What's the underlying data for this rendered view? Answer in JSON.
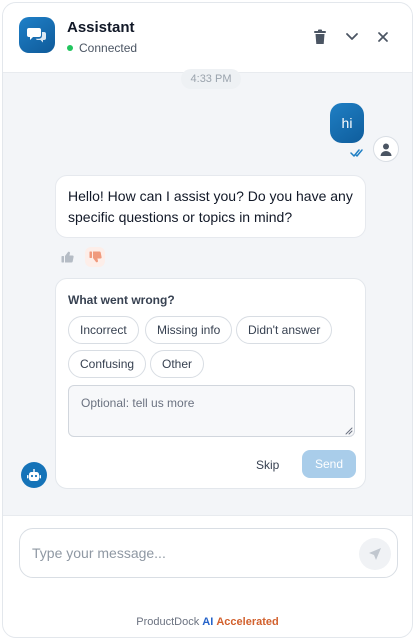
{
  "header": {
    "title": "Assistant",
    "status": "Connected",
    "logo_icon": "chat-bubbles-icon",
    "actions": [
      "trash-icon",
      "chevron-down-icon",
      "close-icon"
    ]
  },
  "chat": {
    "timestamp": "4:33 PM",
    "user_message": "hi",
    "bot_message": "Hello! How can I assist you? Do you have any specific questions or topics in mind?"
  },
  "feedback": {
    "title": "What went wrong?",
    "chips": [
      "Incorrect",
      "Missing info",
      "Didn't answer",
      "Confusing",
      "Other"
    ],
    "placeholder": "Optional: tell us more",
    "skip_label": "Skip",
    "send_label": "Send"
  },
  "composer": {
    "placeholder": "Type your message..."
  },
  "footer": {
    "brand_prefix": "ProductDock",
    "brand_ai": "AI",
    "brand_suffix": "Accelerated"
  },
  "colors": {
    "accent": "#1573b8",
    "status": "#22c55e",
    "send_disabled": "#a9cdea",
    "thumbs_down": "#f09a7d"
  }
}
